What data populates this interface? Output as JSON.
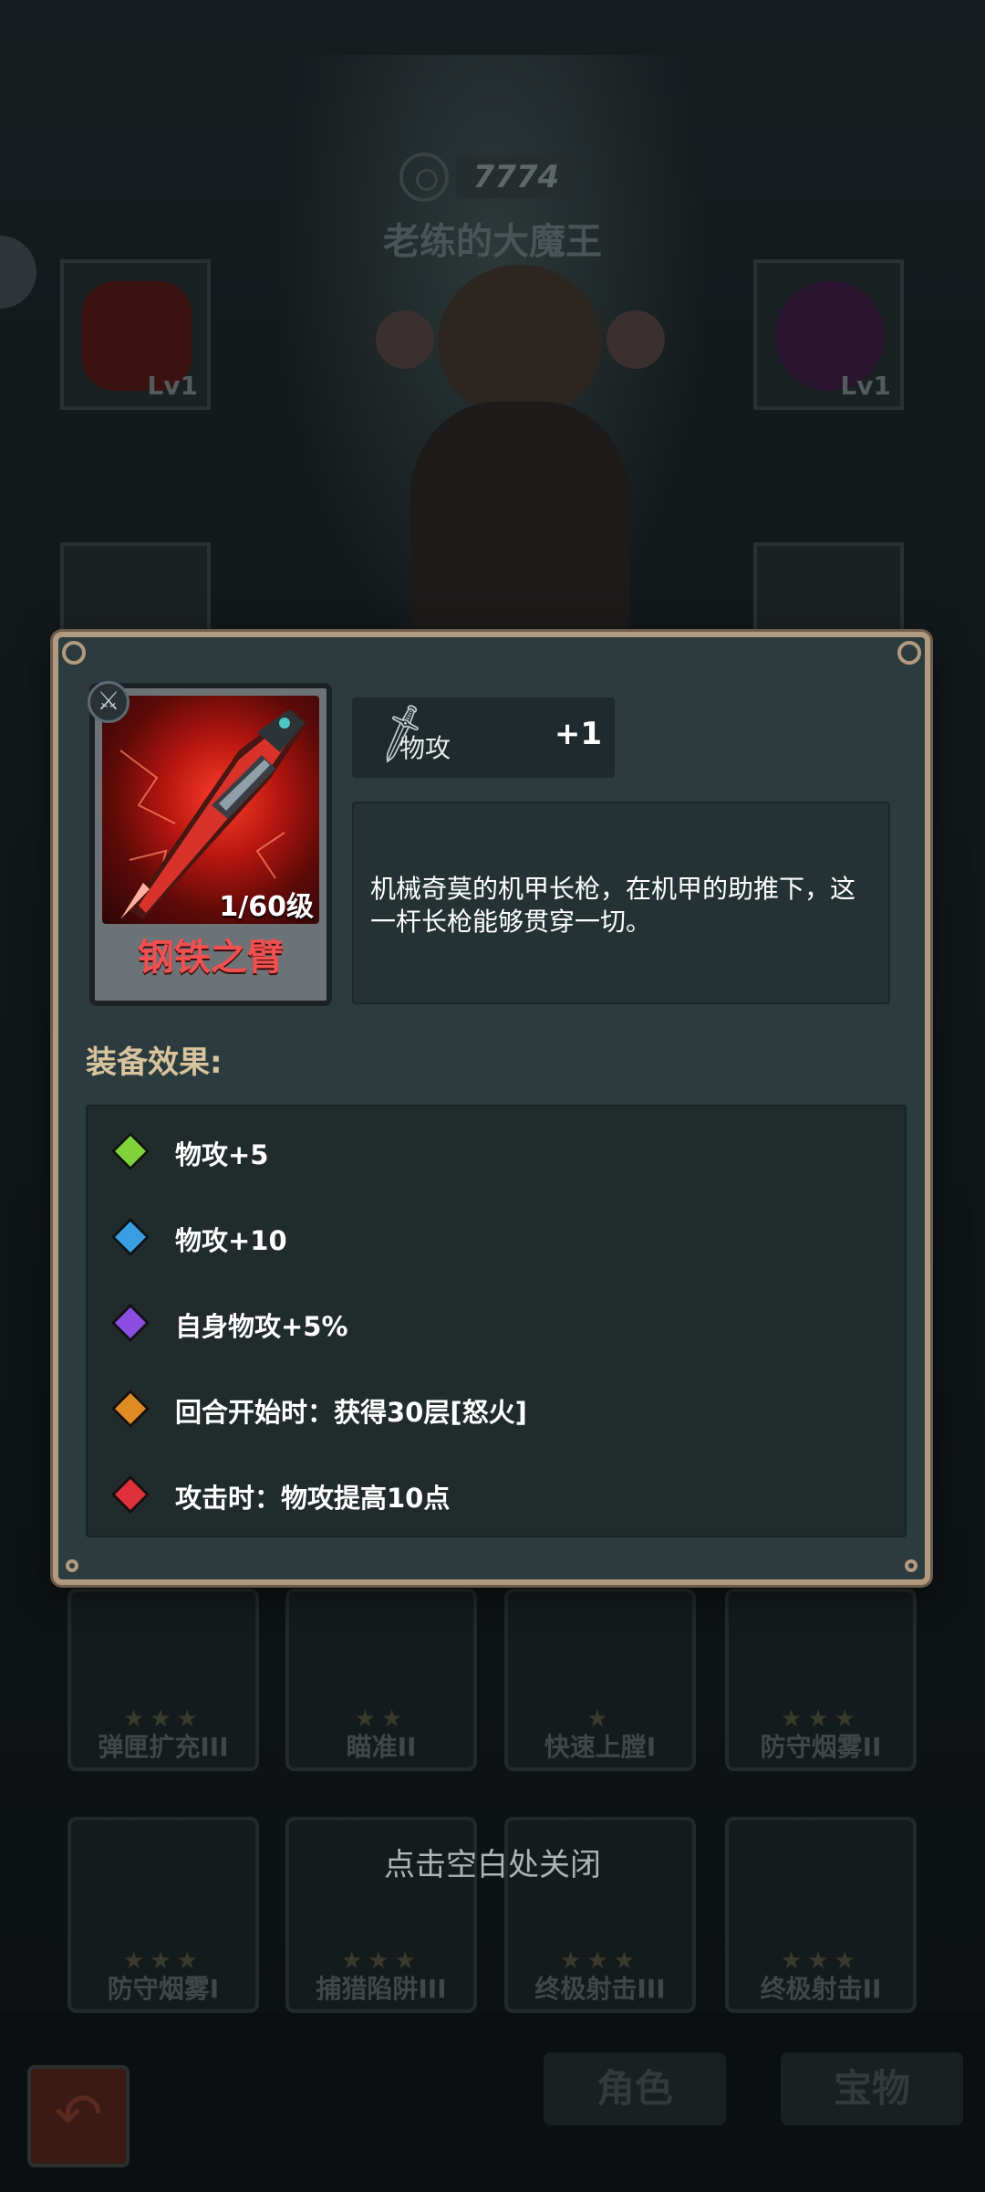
{
  "background": {
    "power_value": "7774",
    "boss_name": "老练的大魔王",
    "slots": [
      {
        "level": "Lv1"
      },
      {
        "level": "Lv1"
      }
    ],
    "cards_row1": [
      {
        "label": "弹匣扩充III"
      },
      {
        "label": "瞄准II"
      },
      {
        "label": "快速上膛I"
      },
      {
        "label": "防守烟雾II"
      }
    ],
    "cards_row2": [
      {
        "label": "防守烟雾I"
      },
      {
        "label": "捕猎陷阱III"
      },
      {
        "label": "终极射击III"
      },
      {
        "label": "终极射击II"
      }
    ],
    "close_hint": "点击空白处关闭",
    "tabs": {
      "role": "角色",
      "treasure": "宝物"
    }
  },
  "modal": {
    "item_name": "钢铁之臂",
    "item_level": "1/60级",
    "stat": {
      "label": "物攻",
      "value": "+1"
    },
    "description": "机械奇莫的机甲长枪，在机甲的助推下，这一杆长枪能够贯穿一切。",
    "effects_title": "装备效果:",
    "effects": [
      {
        "text": "物攻+5",
        "color": "#7fd23a"
      },
      {
        "text": "物攻+10",
        "color": "#3a9fe0"
      },
      {
        "text": "自身物攻+5%",
        "color": "#8a4fe0"
      },
      {
        "text": "回合开始时：获得30层[怒火]",
        "color": "#e08a22"
      },
      {
        "text": "攻击时：物攻提高10点",
        "color": "#e0303a"
      }
    ]
  }
}
